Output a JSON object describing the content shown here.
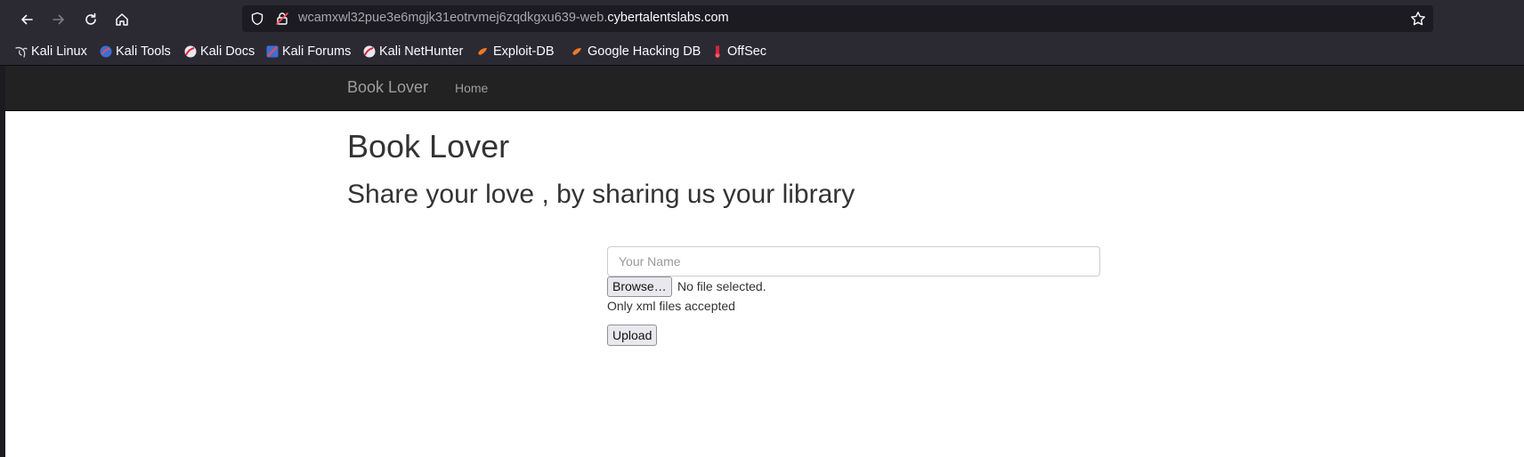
{
  "browser": {
    "url_prefix": "wcamxwl32pue3e6mgjk31eotrvmej6zqdkgxu639-web.",
    "url_domain": "cybertalentslabs.com",
    "bookmarks": [
      {
        "label": "Kali Linux",
        "icon": "kali-dragon-icon"
      },
      {
        "label": "Kali Tools",
        "icon": "kali-tools-icon"
      },
      {
        "label": "Kali Docs",
        "icon": "kali-docs-icon"
      },
      {
        "label": "Kali Forums",
        "icon": "kali-forums-icon"
      },
      {
        "label": "Kali NetHunter",
        "icon": "kali-nethunter-icon"
      },
      {
        "label": "Exploit-DB",
        "icon": "exploit-db-icon"
      },
      {
        "label": "Google Hacking DB",
        "icon": "google-hacking-db-icon"
      },
      {
        "label": "OffSec",
        "icon": "offsec-icon"
      }
    ],
    "colors": {
      "toolbar": "#2b2a33",
      "urlbar": "#1c1b22",
      "text": "#fbfbfe"
    }
  },
  "site": {
    "brand": "Book Lover",
    "nav_home": "Home",
    "heading": "Book Lover",
    "subheading": "Share your love , by sharing us your library",
    "form": {
      "name_placeholder": "Your Name",
      "name_value": "",
      "browse_label": "Browse…",
      "file_status": "No file selected.",
      "help_text": "Only xml files accepted",
      "upload_label": "Upload"
    },
    "colors": {
      "navbar_bg": "#222222",
      "navbar_text": "#9d9d9d",
      "heading_text": "#333333"
    }
  }
}
